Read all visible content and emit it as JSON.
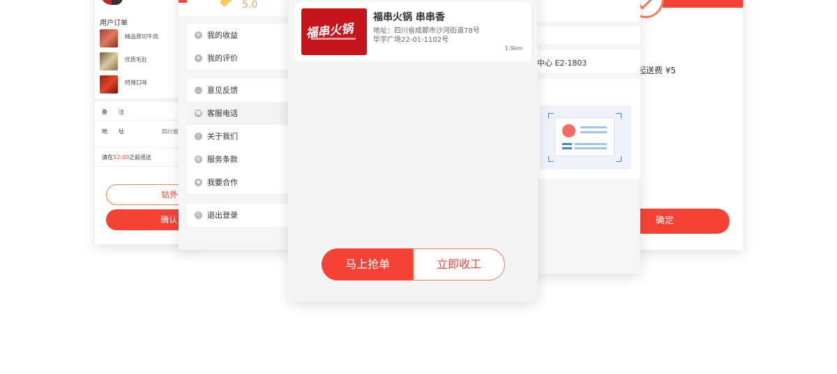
{
  "left_screen": {
    "section_title": "用户订单",
    "items": [
      {
        "name": "精品厚切牛肉"
      },
      {
        "name": "优质毛肚"
      },
      {
        "name": "特辣口味"
      }
    ],
    "remark_label": "备　　注",
    "address_label": "地　　址",
    "address_value": "四川省",
    "deliver_before_prefix": "请在",
    "deliver_before_time": "12:00",
    "deliver_before_suffix": "之前送达",
    "outline_button": "站外",
    "solid_button": "确认"
  },
  "menu_screen": {
    "rating": "5.0",
    "group1": [
      {
        "label": "我的收益",
        "icon": "money-bag-icon"
      },
      {
        "label": "我的评价",
        "icon": "star-icon"
      }
    ],
    "group2": [
      {
        "label": "意见反馈",
        "icon": "chat-bubble-icon"
      },
      {
        "label": "客服电话",
        "icon": "headset-icon"
      },
      {
        "label": "关于我们",
        "icon": "question-icon"
      },
      {
        "label": "服务条款",
        "icon": "gear-icon"
      },
      {
        "label": "我要合作",
        "icon": "handshake-icon"
      }
    ],
    "group3": [
      {
        "label": "退出登录",
        "icon": "power-icon"
      }
    ]
  },
  "center_screen": {
    "shop_logo_text": "福串火锅",
    "shop_name": "福串火锅 串串香",
    "address_line1": "地址：四川省成都市沙河街道78号",
    "address_line2": "华宇广场22-01-1102号",
    "distance": "1.9km",
    "grab_button": "马上抢单",
    "finish_button": "立即收工"
  },
  "right_middle_screen": {
    "address_fragment": "中心 E2-1803"
  },
  "far_right_screen": {
    "fee_text": "起送费 ¥5",
    "confirm_button": "确定"
  },
  "colors": {
    "accent": "#f44336",
    "accent_light": "#f47c55",
    "rating": "#f5a25d"
  }
}
